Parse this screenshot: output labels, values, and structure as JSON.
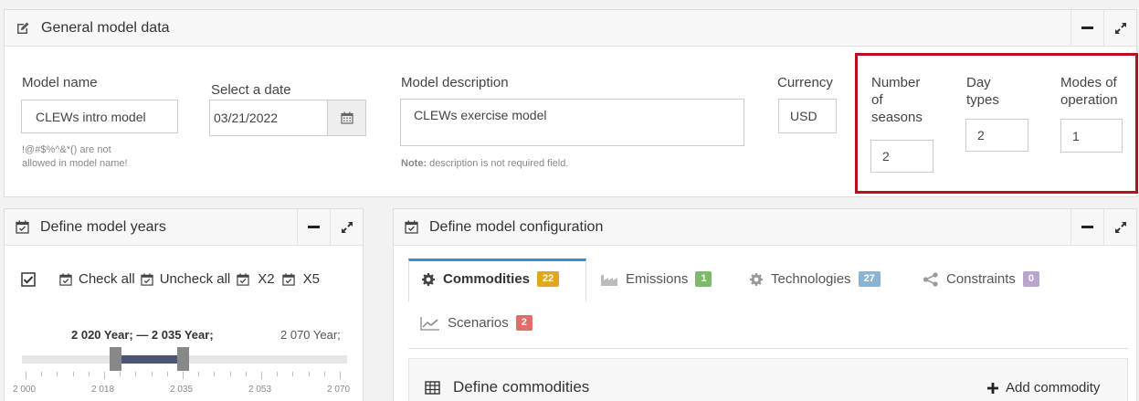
{
  "general": {
    "title": "General model data",
    "model_name_label": "Model name",
    "model_name_value": "CLEWs intro model",
    "model_name_hint_line1": "!@#$%^&*() are not",
    "model_name_hint_line2": "allowed in model name!",
    "date_label": "Select a date",
    "date_value": "03/21/2022",
    "description_label": "Model description",
    "description_value": "CLEWs exercise model",
    "note_bold": "Note:",
    "note_text": " description is not required field.",
    "currency_label": "Currency",
    "currency_value": "USD",
    "seasons_label_1": "Number",
    "seasons_label_2": "of",
    "seasons_label_3": "seasons",
    "seasons_value": "2",
    "daytypes_label_1": "Day",
    "daytypes_label_2": "types",
    "daytypes_value": "2",
    "modes_label_1": "Modes of",
    "modes_label_2": "operation",
    "modes_value": "1"
  },
  "years": {
    "title": "Define model years",
    "check_all": "Check all",
    "uncheck_all": "Uncheck all",
    "x2": "X2",
    "x5": "X5",
    "range_text": "2 020 Year; — 2 035 Year;",
    "end_text": "2 070 Year;",
    "slider_from": 2020,
    "slider_to": 2035,
    "slider_min": 2000,
    "slider_max": 2070,
    "tick_labels": [
      "2 000",
      "2 018",
      "2 035",
      "2 053",
      "2 070"
    ]
  },
  "config": {
    "title": "Define model configuration",
    "tabs": [
      {
        "label": "Commodities",
        "count": "22",
        "color": "#e0a81f",
        "icon": "gear-icon",
        "active": true
      },
      {
        "label": "Emissions",
        "count": "1",
        "color": "#7dbb6b",
        "icon": "factory-icon",
        "active": false
      },
      {
        "label": "Technologies",
        "count": "27",
        "color": "#8ab4d0",
        "icon": "gear-icon",
        "active": false
      },
      {
        "label": "Constraints",
        "count": "0",
        "color": "#b8a6cf",
        "icon": "share-icon",
        "active": false
      }
    ],
    "scenarios_label": "Scenarios",
    "scenarios_count": "2",
    "scenarios_color": "#e16c6c",
    "define_commodities": "Define commodities",
    "add_commodity": "Add commodity"
  },
  "colors": {
    "highlight_border": "#b5101b",
    "active_tab_border": "#3a8ecf",
    "slider_range": "#4a5577"
  }
}
